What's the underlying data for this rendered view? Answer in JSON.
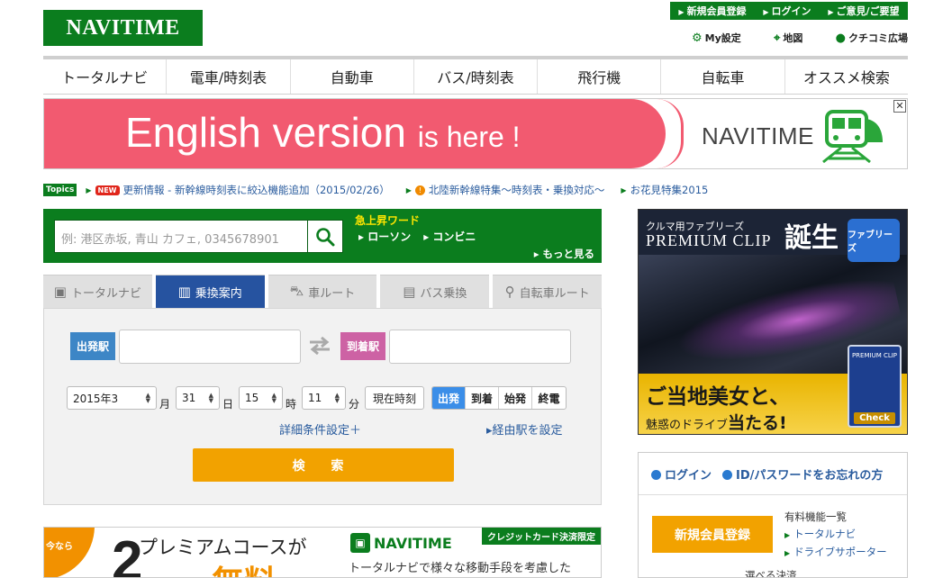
{
  "header": {
    "logo": "NAVITIME",
    "top_links": [
      "新規会員登録",
      "ログイン",
      "ご意見/ご要望"
    ],
    "utils": [
      {
        "label": "My設定",
        "icon": "gear-icon"
      },
      {
        "label": "地図",
        "icon": "pin-icon"
      },
      {
        "label": "クチコミ広場",
        "icon": "chat-icon"
      }
    ]
  },
  "nav": [
    "トータルナビ",
    "電車/時刻表",
    "自動車",
    "バス/時刻表",
    "飛行機",
    "自転車",
    "オススメ検索"
  ],
  "banner": {
    "main": "English version",
    "tail": "is here !",
    "brand": "NAVITIME",
    "close": "✕"
  },
  "topics": {
    "badge": "Topics",
    "new_badge": "NEW",
    "items": [
      "更新情報 - 新幹線時刻表に絞込機能追加（2015/02/26）",
      "北陸新幹線特集〜時刻表・乗換対応〜",
      "お花見特集2015"
    ]
  },
  "search": {
    "placeholder": "例: 港区赤坂, 青山 カフェ, 0345678901",
    "keyword_title": "急上昇ワード",
    "keywords": [
      "ローソン",
      "コンビニ"
    ],
    "more": "もっと見る"
  },
  "route_tabs": [
    {
      "label": "トータルナビ",
      "icon": "box-icon",
      "active": false
    },
    {
      "label": "乗換案内",
      "icon": "train-icon",
      "active": true
    },
    {
      "label": "車ルート",
      "icon": "car-icon",
      "active": false
    },
    {
      "label": "バス乗換",
      "icon": "bus-icon",
      "active": false
    },
    {
      "label": "自転車ルート",
      "icon": "bicycle-icon",
      "active": false
    }
  ],
  "form": {
    "from_label": "出発駅",
    "to_label": "到着駅",
    "from_value": "",
    "to_value": "",
    "date": {
      "month": "2015年3",
      "day": "31",
      "hour": "15",
      "minute": "11"
    },
    "units": {
      "month": "月",
      "day": "日",
      "hour": "時",
      "minute": "分"
    },
    "now_button": "現在時刻",
    "time_modes": [
      "出発",
      "到着",
      "始発",
      "終電"
    ],
    "active_mode": "出発",
    "detail_link": "詳細条件設定＋",
    "via_link": "経由駅を設定",
    "search_button": "検 索"
  },
  "premium_ad": {
    "ribbon": "今なら",
    "big": "2",
    "headline": "プレミアムコースが",
    "muryo": "ー無料",
    "brand": "NAVITIME",
    "desc": "トータルナビで様々な移動手段を考慮した",
    "card": "クレジットカード決済限定"
  },
  "side_ad": {
    "line1": "クルマ用ファブリーズ",
    "line2": "PREMIUM CLIP",
    "line3": "誕生",
    "bottle": "ファブリーズ",
    "bottom1": "ご当地美女と、",
    "bottom2a": "魅惑のドライブ",
    "bottom2b": "当たる!",
    "pkg_label": "PREMIUM CLIP",
    "check": "Check"
  },
  "login_box": {
    "login": "ログイン",
    "forgot": "ID/パスワードをお忘れの方",
    "register": "新規会員登録",
    "list_title": "有料機能一覧",
    "list_items": [
      "トータルナビ",
      "ドライブサポーター"
    ],
    "tail": "選べる決済"
  }
}
